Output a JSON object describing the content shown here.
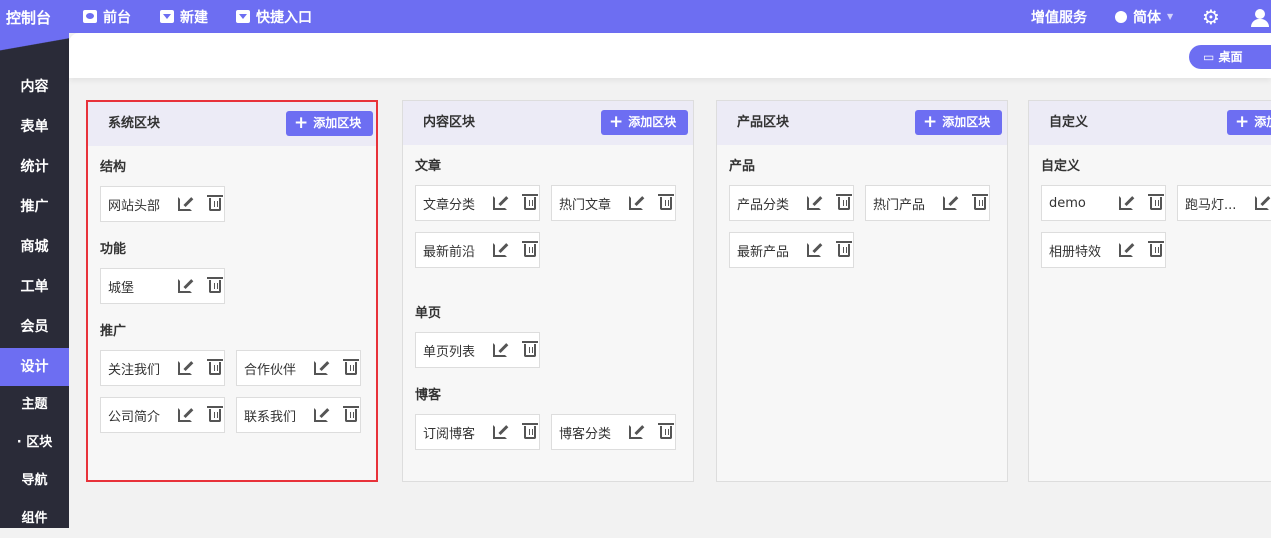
{
  "topbar": {
    "logo": "控制台",
    "nav": [
      "前台",
      "新建",
      "快捷入口"
    ],
    "services": "增值服务",
    "lang": "简体"
  },
  "header": {
    "desktop": "桌面"
  },
  "sidebar": {
    "items": [
      "内容",
      "表单",
      "统计",
      "推广",
      "商城",
      "工单",
      "会员",
      "设计"
    ],
    "active": "设计",
    "sub": [
      "主题",
      "区块",
      "导航",
      "组件"
    ],
    "active_sub": "区块"
  },
  "add_label": "添加区块",
  "cards": [
    {
      "title": "系统区块",
      "groups": [
        {
          "title": "结构",
          "items": [
            "网站头部"
          ]
        },
        {
          "title": "功能",
          "items": [
            "城堡"
          ]
        },
        {
          "title": "推广",
          "items": [
            "关注我们",
            "合作伙伴",
            "公司简介",
            "联系我们"
          ]
        }
      ]
    },
    {
      "title": "内容区块",
      "groups": [
        {
          "title": "文章",
          "items": [
            "文章分类",
            "热门文章",
            "最新前沿"
          ]
        },
        {
          "title": "单页",
          "items": [
            "单页列表"
          ]
        },
        {
          "title": "博客",
          "items": [
            "订阅博客",
            "博客分类"
          ]
        }
      ]
    },
    {
      "title": "产品区块",
      "groups": [
        {
          "title": "产品",
          "items": [
            "产品分类",
            "热门产品",
            "最新产品"
          ]
        }
      ]
    },
    {
      "title": "自定义",
      "groups": [
        {
          "title": "自定义",
          "items": [
            "demo",
            "跑马灯...",
            "相册特效"
          ]
        }
      ]
    }
  ]
}
